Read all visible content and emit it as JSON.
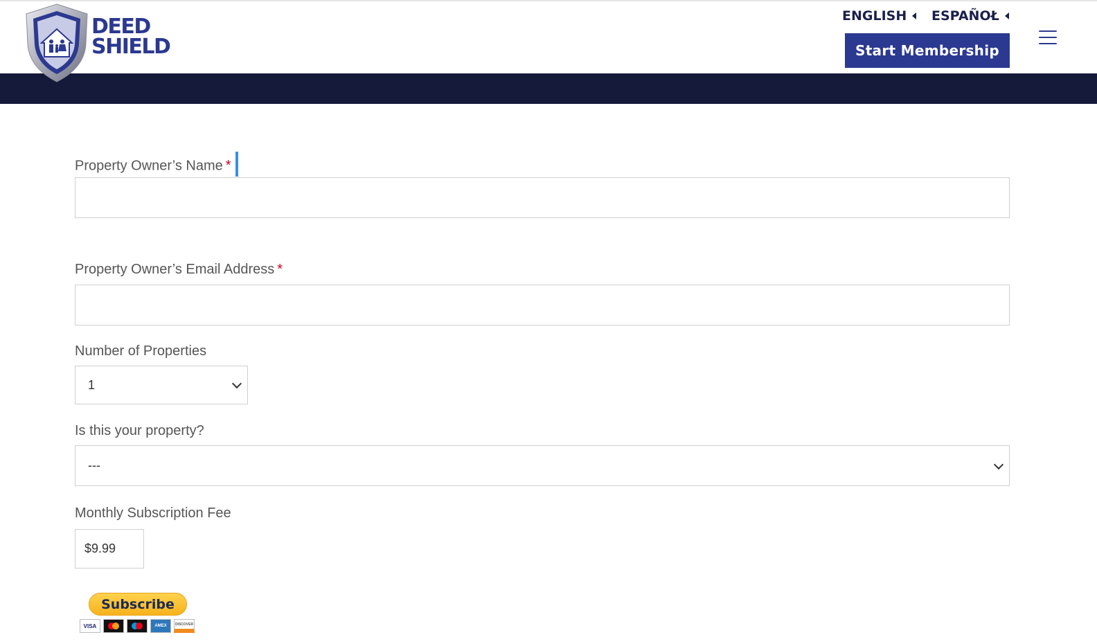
{
  "header": {
    "logo": {
      "line1": "DEED",
      "line2": "SHIELD"
    },
    "languages": [
      "ENGLISH",
      "ESPAÑOŁ"
    ],
    "cta_label": "Start Membership"
  },
  "form": {
    "name": {
      "label": "Property Owner’s Name",
      "required_mark": "*",
      "value": ""
    },
    "email": {
      "label": "Property Owner’s Email Address",
      "required_mark": "*",
      "value": ""
    },
    "properties": {
      "label": "Number of Properties",
      "selected": "1"
    },
    "ownership": {
      "label": "Is this your property?",
      "selected": "---"
    },
    "fee": {
      "label": "Monthly Subscription Fee",
      "value": "$9.99"
    },
    "subscribe_label": "Subscribe",
    "cards": [
      "VISA",
      "Mastercard",
      "Maestro",
      "AMEX",
      "DISCOVER"
    ],
    "card_texts": {
      "visa": "VISA",
      "amex": "AMEX",
      "discover": "DISCOVER"
    }
  },
  "colors": {
    "brand_blue": "#2b3990",
    "navy_band": "#151a3b",
    "required_red": "#d0021b",
    "paypal_yellow": "#ffc439"
  }
}
